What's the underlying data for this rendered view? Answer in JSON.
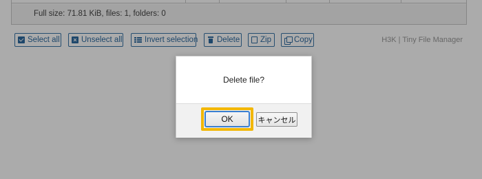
{
  "file_table": {
    "footer_text": "Full size: 71.81 KiB, files: 1, folders: 0"
  },
  "toolbar": {
    "select_all": "Select all",
    "unselect_all": "Unselect all",
    "invert_selection": "Invert selection",
    "delete": "Delete",
    "zip": "Zip",
    "copy": "Copy"
  },
  "brand": "H3K | Tiny File Manager",
  "dialog": {
    "message": "Delete file?",
    "ok_label": "OK",
    "cancel_label": "キャンセル"
  },
  "colors": {
    "accent": "#2e6aa0",
    "highlight": "#f2b705",
    "overlay": "#00000055"
  }
}
